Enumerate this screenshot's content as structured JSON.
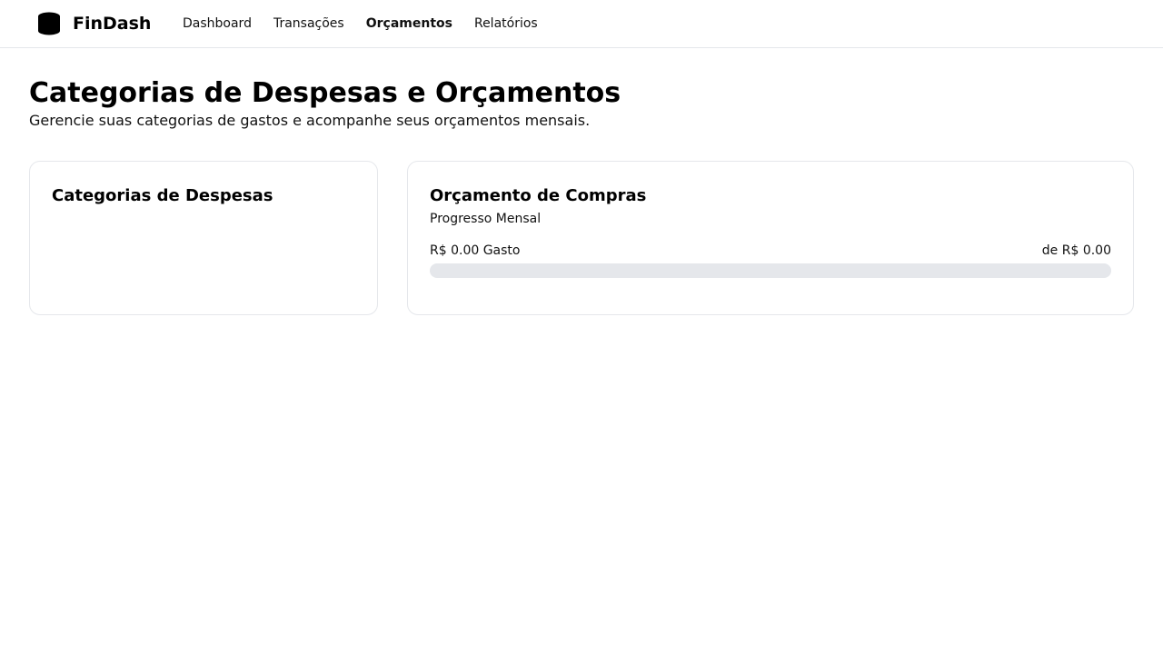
{
  "app": {
    "name": "FinDash",
    "logo_icon": "stacked-coins-icon"
  },
  "nav": {
    "items": [
      {
        "label": "Dashboard",
        "active": false
      },
      {
        "label": "Transações",
        "active": false
      },
      {
        "label": "Orçamentos",
        "active": true
      },
      {
        "label": "Relatórios",
        "active": false
      }
    ]
  },
  "page": {
    "title": "Categorias de Despesas e Orçamentos",
    "subtitle": "Gerencie suas categorias de gastos e acompanhe seus orçamentos mensais."
  },
  "categories_card": {
    "title": "Categorias de Despesas",
    "items": []
  },
  "budget_card": {
    "title": "Orçamento de Compras",
    "subtitle": "Progresso Mensal",
    "spent_label": "R$ 0.00 Gasto",
    "total_label": "de R$ 0.00",
    "progress_fraction": 0,
    "track_color": "#e5e7eb",
    "fill_color": "#111111"
  }
}
